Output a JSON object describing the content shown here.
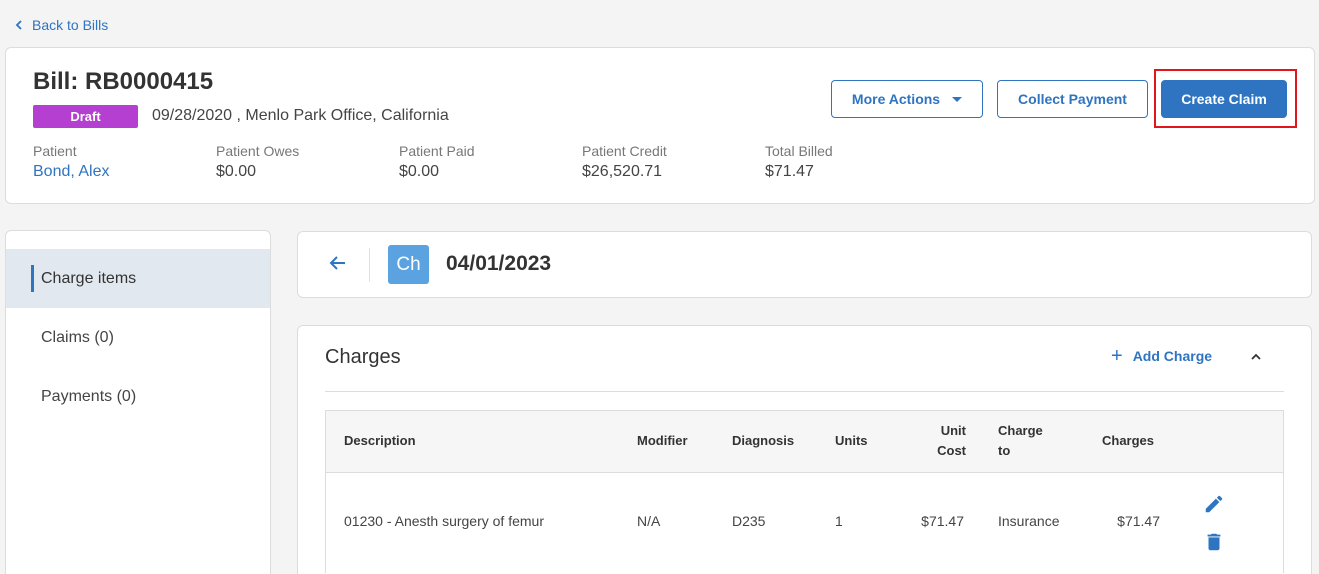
{
  "nav": {
    "back_label": "Back to Bills"
  },
  "bill": {
    "title": "Bill: RB0000415",
    "status": "Draft",
    "meta": "09/28/2020 , Menlo Park Office, California",
    "stats": [
      {
        "label": "Patient",
        "value": "Bond, Alex"
      },
      {
        "label": "Patient Owes",
        "value": "$0.00"
      },
      {
        "label": "Patient Paid",
        "value": "$0.00"
      },
      {
        "label": "Patient Credit",
        "value": "$26,520.71"
      },
      {
        "label": "Total Billed",
        "value": "$71.47"
      }
    ]
  },
  "actions": {
    "more_actions": "More Actions",
    "collect_payment": "Collect Payment",
    "create_claim": "Create Claim"
  },
  "sidebar": {
    "items": [
      {
        "label": "Charge items"
      },
      {
        "label": "Claims (0)"
      },
      {
        "label": "Payments (0)"
      }
    ]
  },
  "encounter": {
    "avatar": "Ch",
    "date": "04/01/2023"
  },
  "charges": {
    "title": "Charges",
    "add_label": "Add Charge",
    "headers": {
      "description": "Description",
      "modifier": "Modifier",
      "diagnosis": "Diagnosis",
      "units": "Units",
      "unit_cost_1": "Unit",
      "unit_cost_2": "Cost",
      "charge_to_1": "Charge",
      "charge_to_2": "to",
      "charges": "Charges"
    },
    "rows": [
      {
        "description": "01230 - Anesth surgery of femur",
        "modifier": "N/A",
        "diagnosis": "D235",
        "units": "1",
        "unit_cost": "$71.47",
        "charge_to": "Insurance",
        "charges": "$71.47"
      }
    ]
  },
  "colors": {
    "accent": "#2f74c0",
    "draft_badge": "#b43fd1",
    "highlight": "#e0161c"
  }
}
